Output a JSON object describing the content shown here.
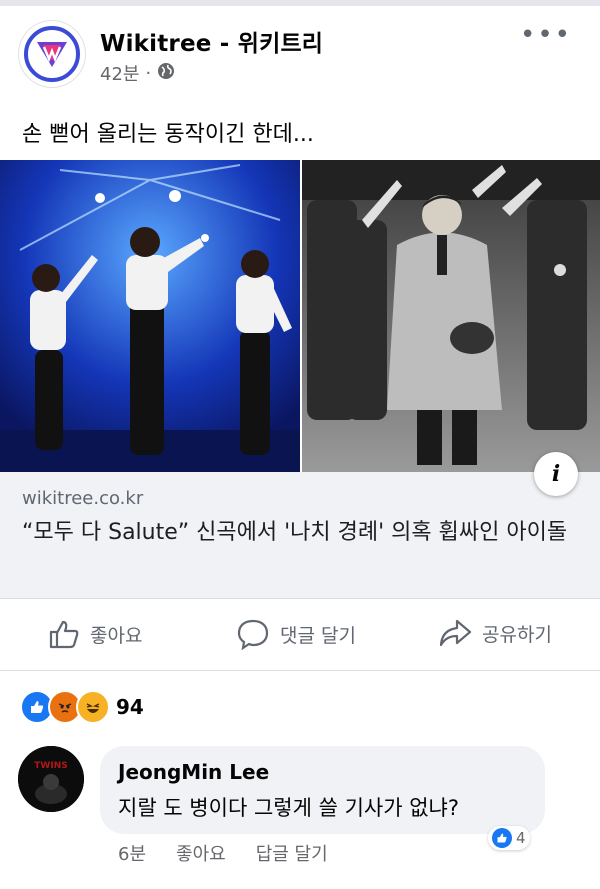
{
  "post": {
    "page_name": "Wikitree - 위키트리",
    "time": "42분",
    "separator": "·",
    "visibility_icon": "globe-icon",
    "text": "손 뻗어 올리는 동작이긴 한데..."
  },
  "link": {
    "domain": "wikitree.co.kr",
    "title": "“모두 다 Salute” 신곡에서 '나치 경례' 의혹 휩싸인 아이돌",
    "info_icon": "i"
  },
  "actions": {
    "like": "좋아요",
    "comment": "댓글 달기",
    "share": "공유하기"
  },
  "reactions": {
    "icons": [
      "like-icon",
      "angry-icon",
      "haha-icon"
    ],
    "count": "94"
  },
  "comment": {
    "author": "JeongMin Lee",
    "text": "지랄 도 병이다 그렇게 쓸 기사가 없냐?",
    "time": "6분",
    "like": "좋아요",
    "reply": "답글 달기",
    "like_count": "4"
  },
  "colors": {
    "brand_blue": "#1877f2",
    "angry": "#e9710f",
    "haha": "#f7b125"
  }
}
